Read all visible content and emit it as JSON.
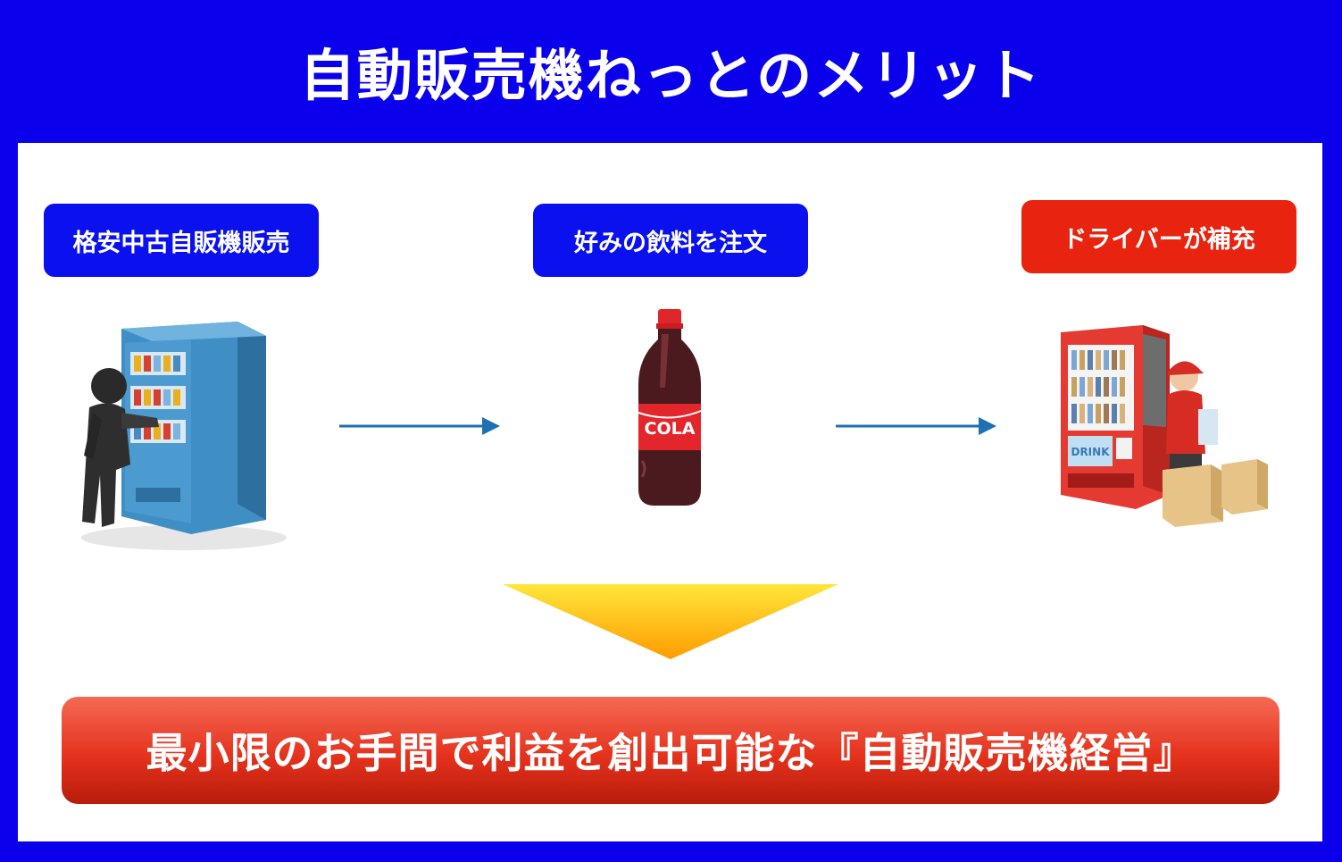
{
  "header": {
    "title": "自動販売機ねっとのメリット"
  },
  "steps": [
    {
      "label": "格安中古自販機販売",
      "color": "#0a10ee"
    },
    {
      "label": "好みの飲料を注文",
      "color": "#0a10ee"
    },
    {
      "label": "ドライバーが補充",
      "color": "#e8230f"
    }
  ],
  "cola": {
    "text": "COLA"
  },
  "vending_sign": {
    "text": "DRINK"
  },
  "result": {
    "text": "最小限のお手間で利益を創出可能な『自動販売機経営』"
  },
  "colors": {
    "frame": "#0b00ec",
    "arrow": "#1f6fb3",
    "result_top": "#f46a55",
    "result_bottom": "#b81c0b",
    "triangle_top": "#ffe63a",
    "triangle_bottom": "#ff9c00"
  }
}
